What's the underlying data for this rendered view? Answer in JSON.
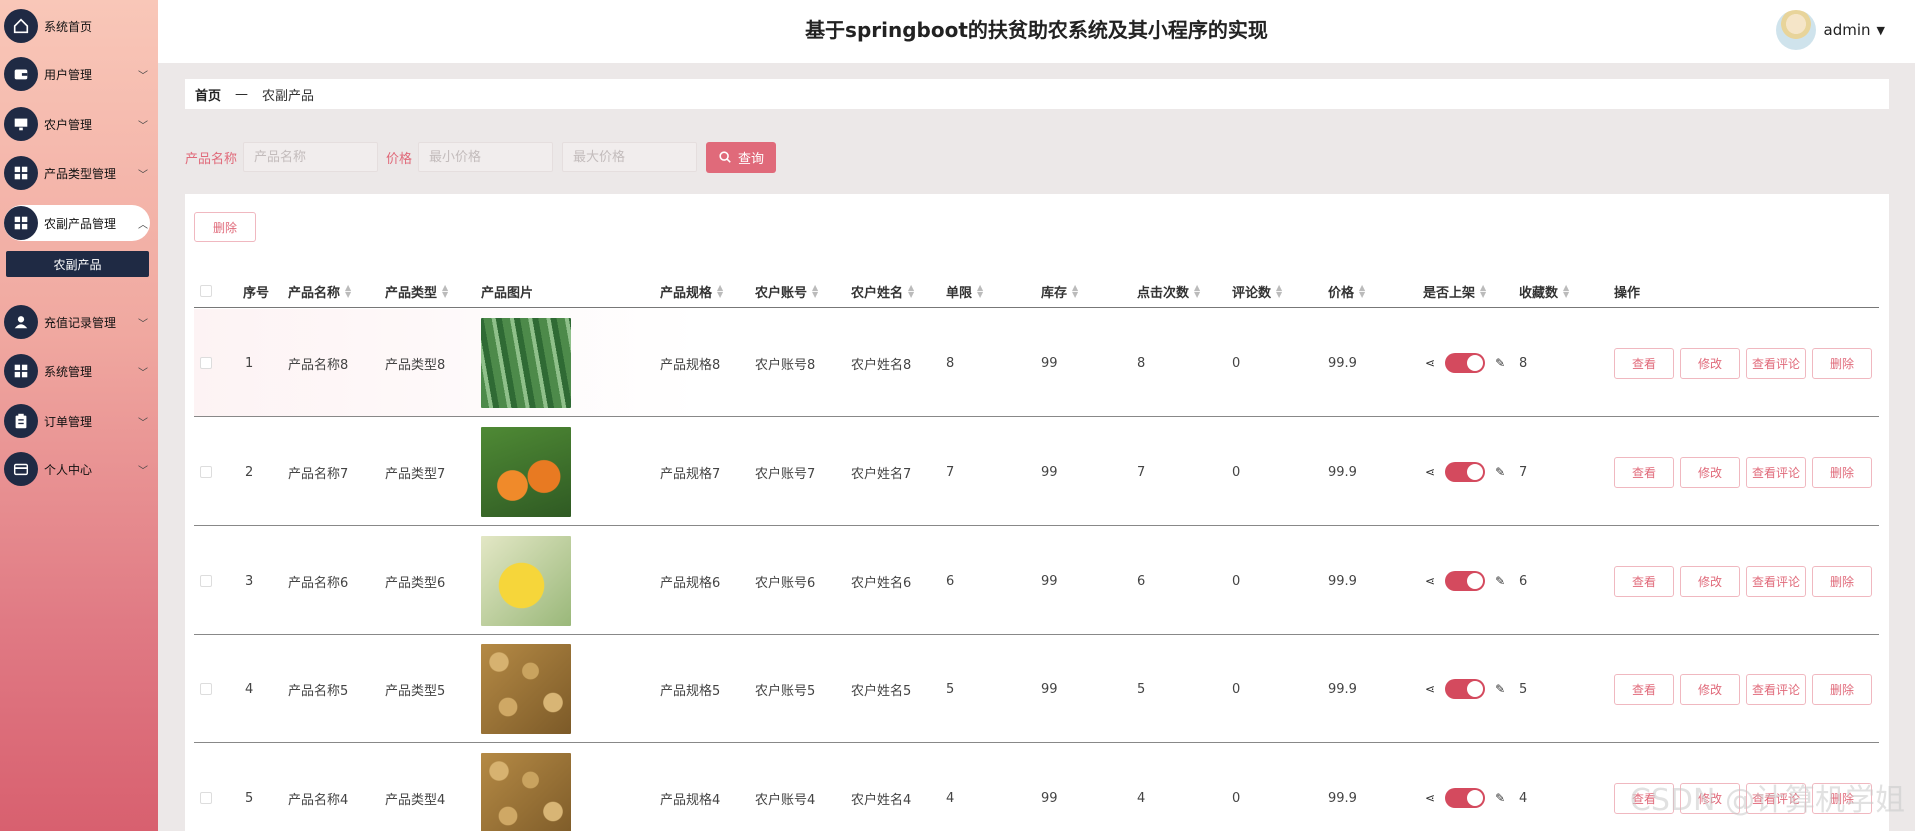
{
  "app": {
    "title": "基于springboot的扶贫助农系统及其小程序的实现",
    "user": "admin"
  },
  "sidebar": {
    "items": [
      {
        "label": "系统首页",
        "icon": "home-icon"
      },
      {
        "label": "用户管理",
        "icon": "wallet-icon"
      },
      {
        "label": "农户管理",
        "icon": "monitor-icon"
      },
      {
        "label": "产品类型管理",
        "icon": "grid-icon"
      },
      {
        "label": "农副产品管理",
        "icon": "grid-icon"
      },
      {
        "label": "充值记录管理",
        "icon": "person-icon"
      },
      {
        "label": "系统管理",
        "icon": "grid-icon"
      },
      {
        "label": "订单管理",
        "icon": "clipboard-icon"
      },
      {
        "label": "个人中心",
        "icon": "card-icon"
      }
    ],
    "sub_active": "农副产品"
  },
  "breadcrumb": {
    "home": "首页",
    "sep": "—",
    "current": "农副产品"
  },
  "search": {
    "name_label": "产品名称",
    "name_placeholder": "产品名称",
    "price_label": "价格",
    "min_placeholder": "最小价格",
    "max_placeholder": "最大价格",
    "query_label": "查询"
  },
  "toolbar": {
    "delete_label": "删除"
  },
  "table": {
    "headers": [
      "序号",
      "产品名称",
      "产品类型",
      "产品图片",
      "产品规格",
      "农户账号",
      "农户姓名",
      "单限",
      "库存",
      "点击次数",
      "评论数",
      "价格",
      "是否上架",
      "收藏数",
      "操作"
    ],
    "rows": [
      {
        "no": "1",
        "name": "产品名称8",
        "type": "产品类型8",
        "spec": "产品规格8",
        "account": "农户账号8",
        "farmer": "农户姓名8",
        "limit": "8",
        "stock": "99",
        "clicks": "8",
        "comments": "0",
        "price": "99.9",
        "favorites": "8"
      },
      {
        "no": "2",
        "name": "产品名称7",
        "type": "产品类型7",
        "spec": "产品规格7",
        "account": "农户账号7",
        "farmer": "农户姓名7",
        "limit": "7",
        "stock": "99",
        "clicks": "7",
        "comments": "0",
        "price": "99.9",
        "favorites": "7"
      },
      {
        "no": "3",
        "name": "产品名称6",
        "type": "产品类型6",
        "spec": "产品规格6",
        "account": "农户账号6",
        "farmer": "农户姓名6",
        "limit": "6",
        "stock": "99",
        "clicks": "6",
        "comments": "0",
        "price": "99.9",
        "favorites": "6"
      },
      {
        "no": "4",
        "name": "产品名称5",
        "type": "产品类型5",
        "spec": "产品规格5",
        "account": "农户账号5",
        "farmer": "农户姓名5",
        "limit": "5",
        "stock": "99",
        "clicks": "5",
        "comments": "0",
        "price": "99.9",
        "favorites": "5"
      },
      {
        "no": "5",
        "name": "产品名称4",
        "type": "产品类型4",
        "spec": "产品规格4",
        "account": "农户账号4",
        "farmer": "农户姓名4",
        "limit": "4",
        "stock": "99",
        "clicks": "4",
        "comments": "0",
        "price": "99.9",
        "favorites": "4"
      }
    ],
    "ops": {
      "view": "查看",
      "edit": "修改",
      "reviews": "查看评论",
      "delete": "删除"
    }
  },
  "watermark": "CSDN @计算机学姐",
  "colors": {
    "accent": "#e06a7a",
    "nav_dark": "#1f2a44",
    "toggle_on": "#d44a5e"
  }
}
